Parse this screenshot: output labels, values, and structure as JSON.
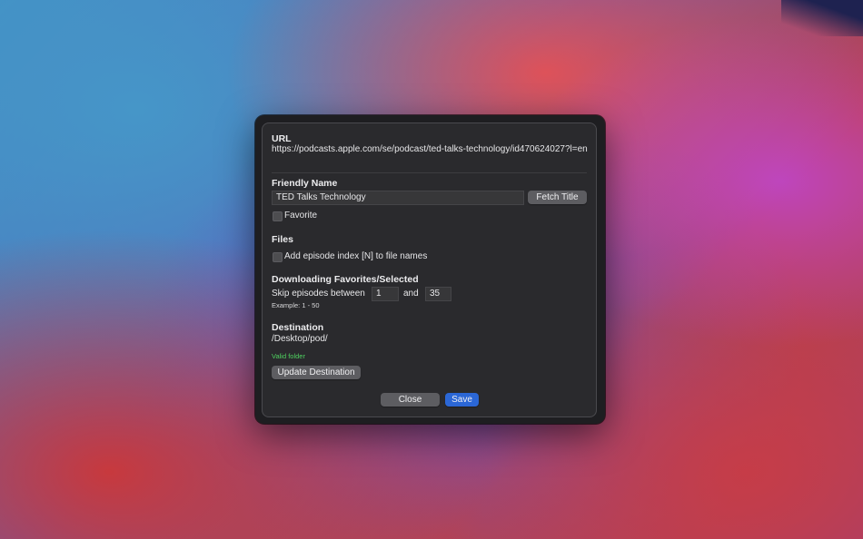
{
  "url_section": {
    "label": "URL",
    "value": "https://podcasts.apple.com/se/podcast/ted-talks-technology/id470624027?l=en"
  },
  "friendly_name": {
    "label": "Friendly Name",
    "value": "TED Talks Technology",
    "fetch_button": "Fetch Title",
    "favorite_label": "Favorite",
    "favorite_checked": false
  },
  "files": {
    "label": "Files",
    "index_label": "Add episode index [N] to file names",
    "index_checked": false
  },
  "downloading": {
    "label": "Downloading Favorites/Selected",
    "skip_label": "Skip episodes between",
    "from_value": "1",
    "and_label": "and",
    "to_value": "35",
    "example": "Example: 1 - 50"
  },
  "destination": {
    "label": "Destination",
    "path": "/Desktop/pod/",
    "status": "Valid folder",
    "status_color": "#4fd160",
    "update_button": "Update Destination"
  },
  "footer": {
    "close_button": "Close",
    "save_button": "Save",
    "save_color": "#2b67d6"
  }
}
